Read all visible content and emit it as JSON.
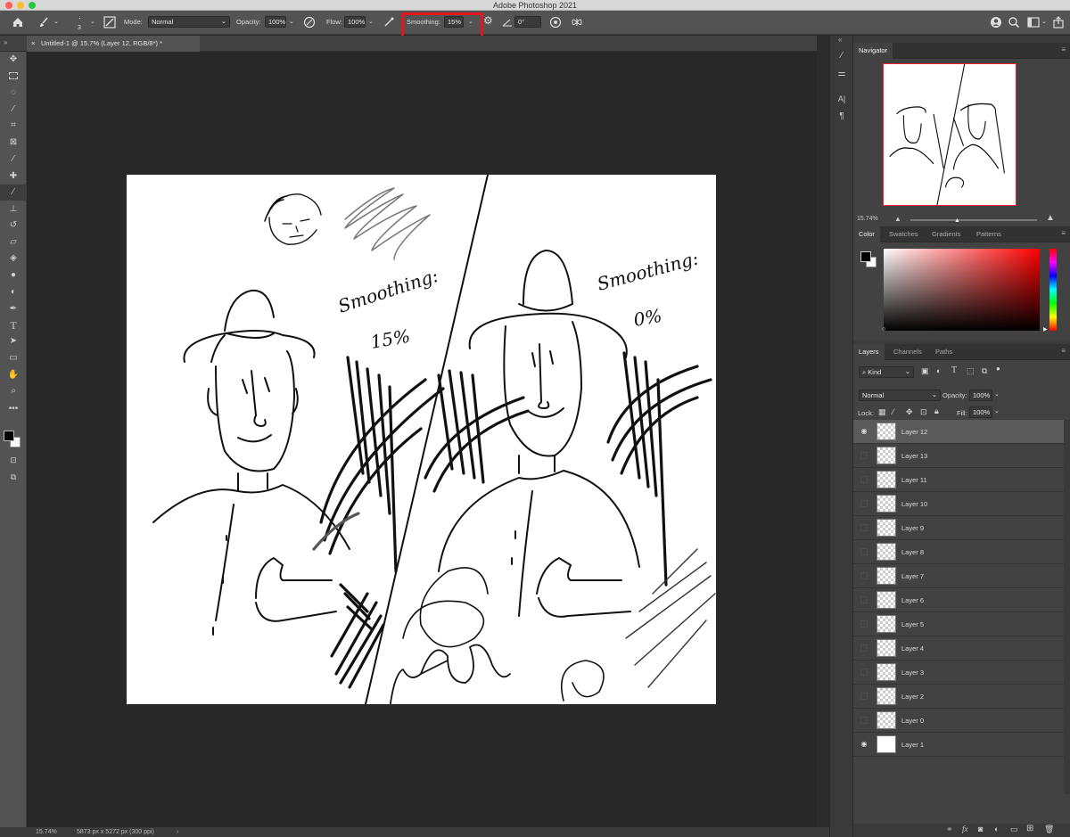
{
  "window": {
    "title": "Adobe Photoshop 2021"
  },
  "options_bar": {
    "brush_size": "3",
    "mode_label": "Mode:",
    "mode_value": "Normal",
    "opacity_label": "Opacity:",
    "opacity_value": "100%",
    "flow_label": "Flow:",
    "flow_value": "100%",
    "smoothing_label": "Smoothing:",
    "smoothing_value": "15%",
    "angle_value": "0°"
  },
  "document": {
    "tab_title": "Untitled-1 @ 15.7% (Layer 12, RGB/8*) *"
  },
  "status": {
    "zoom": "15.74%",
    "doc_info": "5873 px x 5272 px (300 ppi)"
  },
  "canvas_text": {
    "left_label_1": "Smoothing:",
    "left_label_2": "15%",
    "right_label_1": "Smoothing:",
    "right_label_2": "0%"
  },
  "navigator": {
    "tab": "Navigator",
    "zoom": "15.74%"
  },
  "color_panel": {
    "tabs": [
      "Color",
      "Swatches",
      "Gradients",
      "Patterns"
    ],
    "foreground": "#000000",
    "background": "#ffffff",
    "hue_base": "#ff0000"
  },
  "layers_panel": {
    "tabs": [
      "Layers",
      "Channels",
      "Paths"
    ],
    "filter_kind": "Kind",
    "blend_mode": "Normal",
    "opacity_label": "Opacity:",
    "opacity_value": "100%",
    "lock_label": "Lock:",
    "fill_label": "Fill:",
    "fill_value": "100%",
    "layers": [
      {
        "name": "Layer 12",
        "visible": true,
        "selected": true
      },
      {
        "name": "Layer 13",
        "visible": false
      },
      {
        "name": "Layer 11",
        "visible": false
      },
      {
        "name": "Layer 10",
        "visible": false
      },
      {
        "name": "Layer 9",
        "visible": false
      },
      {
        "name": "Layer 8",
        "visible": false
      },
      {
        "name": "Layer 7",
        "visible": false
      },
      {
        "name": "Layer 6",
        "visible": false
      },
      {
        "name": "Layer 5",
        "visible": false
      },
      {
        "name": "Layer 4",
        "visible": false
      },
      {
        "name": "Layer 3",
        "visible": false
      },
      {
        "name": "Layer 2",
        "visible": false
      },
      {
        "name": "Layer 0",
        "visible": false
      },
      {
        "name": "Layer 1",
        "visible": true
      }
    ]
  },
  "accent": {
    "highlight": "#e4161c"
  }
}
